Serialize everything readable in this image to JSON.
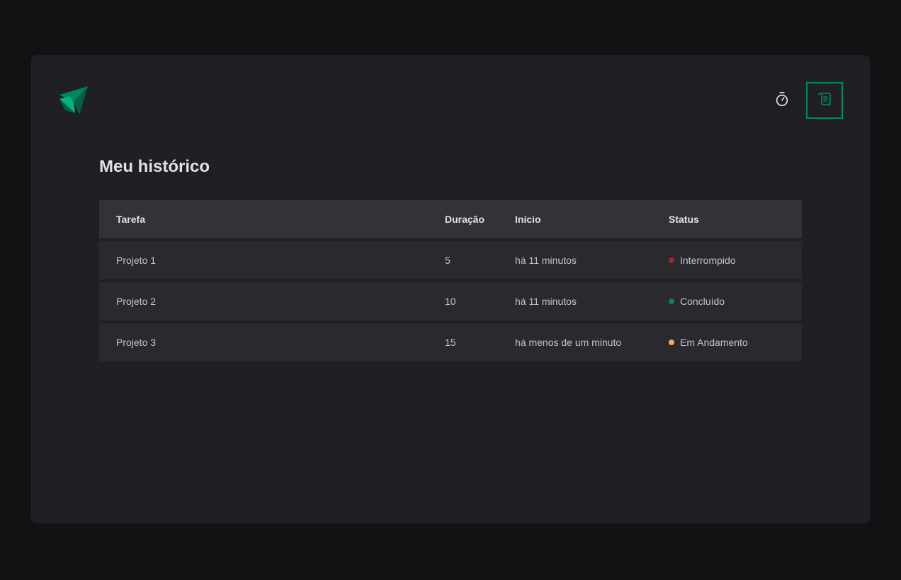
{
  "page": {
    "title": "Meu histórico"
  },
  "nav": {
    "items": [
      {
        "icon": "timer-icon",
        "active": false
      },
      {
        "icon": "scroll-icon",
        "active": true
      }
    ]
  },
  "colors": {
    "accent": "#00875f",
    "interrupted": "#ab222e",
    "completed": "#00875f",
    "in_progress": "#fba94c"
  },
  "table": {
    "headers": {
      "task": "Tarefa",
      "duration": "Duração",
      "start": "Início",
      "status": "Status"
    },
    "rows": [
      {
        "task": "Projeto 1",
        "duration": "5",
        "start": "há 11 minutos",
        "status": "Interrompido",
        "status_color": "#ab222e"
      },
      {
        "task": "Projeto 2",
        "duration": "10",
        "start": "há 11 minutos",
        "status": "Concluído",
        "status_color": "#00875f"
      },
      {
        "task": "Projeto 3",
        "duration": "15",
        "start": "há menos de um minuto",
        "status": "Em Andamento",
        "status_color": "#fba94c"
      }
    ]
  }
}
